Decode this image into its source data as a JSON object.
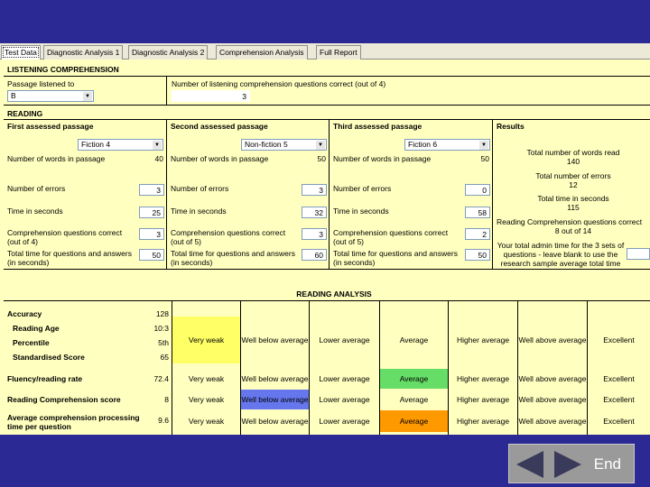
{
  "tabs": [
    "Test Data",
    "Diagnostic Analysis 1",
    "Diagnostic Analysis 2",
    "Comprehension Analysis",
    "Full Report"
  ],
  "listening": {
    "heading": "LISTENING COMPREHENSION",
    "passage_label": "Passage listened to",
    "passage_value": "B",
    "questions_label": "Number of listening comprehension questions correct (out of 4)",
    "questions_value": "3"
  },
  "reading": {
    "heading": "READING",
    "first": {
      "heading": "First assessed passage",
      "passage": "Fiction 4",
      "words_label": "Number of words in passage",
      "words": "40",
      "errors_label": "Number of errors",
      "errors": "3",
      "time_label": "Time in seconds",
      "time": "25",
      "comp_label": "Comprehension questions correct (out of 4)",
      "comp": "3",
      "total_label": "Total time for questions and answers (in seconds)",
      "total": "50"
    },
    "second": {
      "heading": "Second assessed passage",
      "passage": "Non-fiction 5",
      "words_label": "Number of words in passage",
      "words": "50",
      "errors_label": "Number of errors",
      "errors": "3",
      "time_label": "Time in seconds",
      "time": "32",
      "comp_label": "Comprehension questions correct (out of 5)",
      "comp": "3",
      "total_label": "Total time for questions and answers (in seconds)",
      "total": "60"
    },
    "third": {
      "heading": "Third assessed passage",
      "passage": "Fiction 6",
      "words_label": "Number of words in passage",
      "words": "50",
      "errors_label": "Number of errors",
      "errors": "0",
      "time_label": "Time in seconds",
      "time": "58",
      "comp_label": "Comprehension questions correct (out of 5)",
      "comp": "2",
      "total_label": "Total time for questions and answers (in seconds)",
      "total": "50"
    },
    "results": {
      "heading": "Results",
      "words_label": "Total number of words read",
      "words": "140",
      "errors_label": "Total number of errors",
      "errors": "12",
      "time_label": "Total time in seconds",
      "time": "115",
      "comp_label": "Reading Comprehension questions correct",
      "comp": "8 out of 14",
      "admin_label": "Your total admin time for the 3 sets of questions - leave blank to use the research sample average total time"
    }
  },
  "analysis": {
    "heading": "READING ANALYSIS",
    "rows": [
      {
        "label": "Accuracy",
        "value": "128"
      },
      {
        "label": "Reading Age",
        "value": "10:3"
      },
      {
        "label": "Percentile",
        "value": "5th"
      },
      {
        "label": "Standardised Score",
        "value": "65"
      },
      {
        "label": "Fluency/reading rate",
        "value": "72.4"
      },
      {
        "label": "Reading Comprehension score",
        "value": "8"
      },
      {
        "label": "Average comprehension processing time per question",
        "value": "9.6"
      }
    ],
    "bands": [
      "Very weak",
      "Well below average",
      "Lower average",
      "Average",
      "Higher average",
      "Well above average",
      "Excellent"
    ],
    "highlight_colors": {
      "accuracy": "#ffff66",
      "fluency": "#66dd66",
      "comprehension": "#6677ee",
      "processing": "#ff9900"
    }
  },
  "nav": {
    "end_label": "End"
  }
}
